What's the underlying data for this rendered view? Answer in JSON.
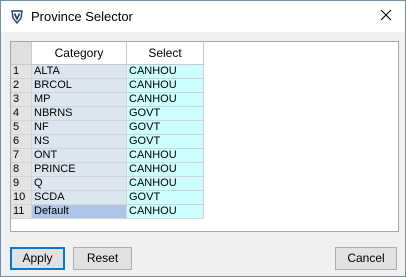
{
  "window": {
    "title": "Province Selector",
    "close_glyph": "✕",
    "icon": "app-shield-icon"
  },
  "grid": {
    "columns": [
      "Category",
      "Select"
    ],
    "rows": [
      {
        "num": "1",
        "category": "ALTA",
        "select": "CANHOU"
      },
      {
        "num": "2",
        "category": "BRCOL",
        "select": "CANHOU"
      },
      {
        "num": "3",
        "category": "MP",
        "select": "CANHOU"
      },
      {
        "num": "4",
        "category": "NBRNS",
        "select": "GOVT"
      },
      {
        "num": "5",
        "category": "NF",
        "select": "GOVT"
      },
      {
        "num": "6",
        "category": "NS",
        "select": "GOVT"
      },
      {
        "num": "7",
        "category": "ONT",
        "select": "CANHOU"
      },
      {
        "num": "8",
        "category": "PRINCE",
        "select": "CANHOU"
      },
      {
        "num": "9",
        "category": "Q",
        "select": "CANHOU"
      },
      {
        "num": "10",
        "category": "SCDA",
        "select": "GOVT"
      },
      {
        "num": "11",
        "category": "Default",
        "select": "CANHOU"
      }
    ]
  },
  "buttons": {
    "apply": "Apply",
    "reset": "Reset",
    "cancel": "Cancel"
  },
  "colors": {
    "category_cell": "#dce6f1",
    "category_selected": "#aec5e8",
    "select_cell": "#ccffff",
    "focus_border": "#0078d7"
  }
}
